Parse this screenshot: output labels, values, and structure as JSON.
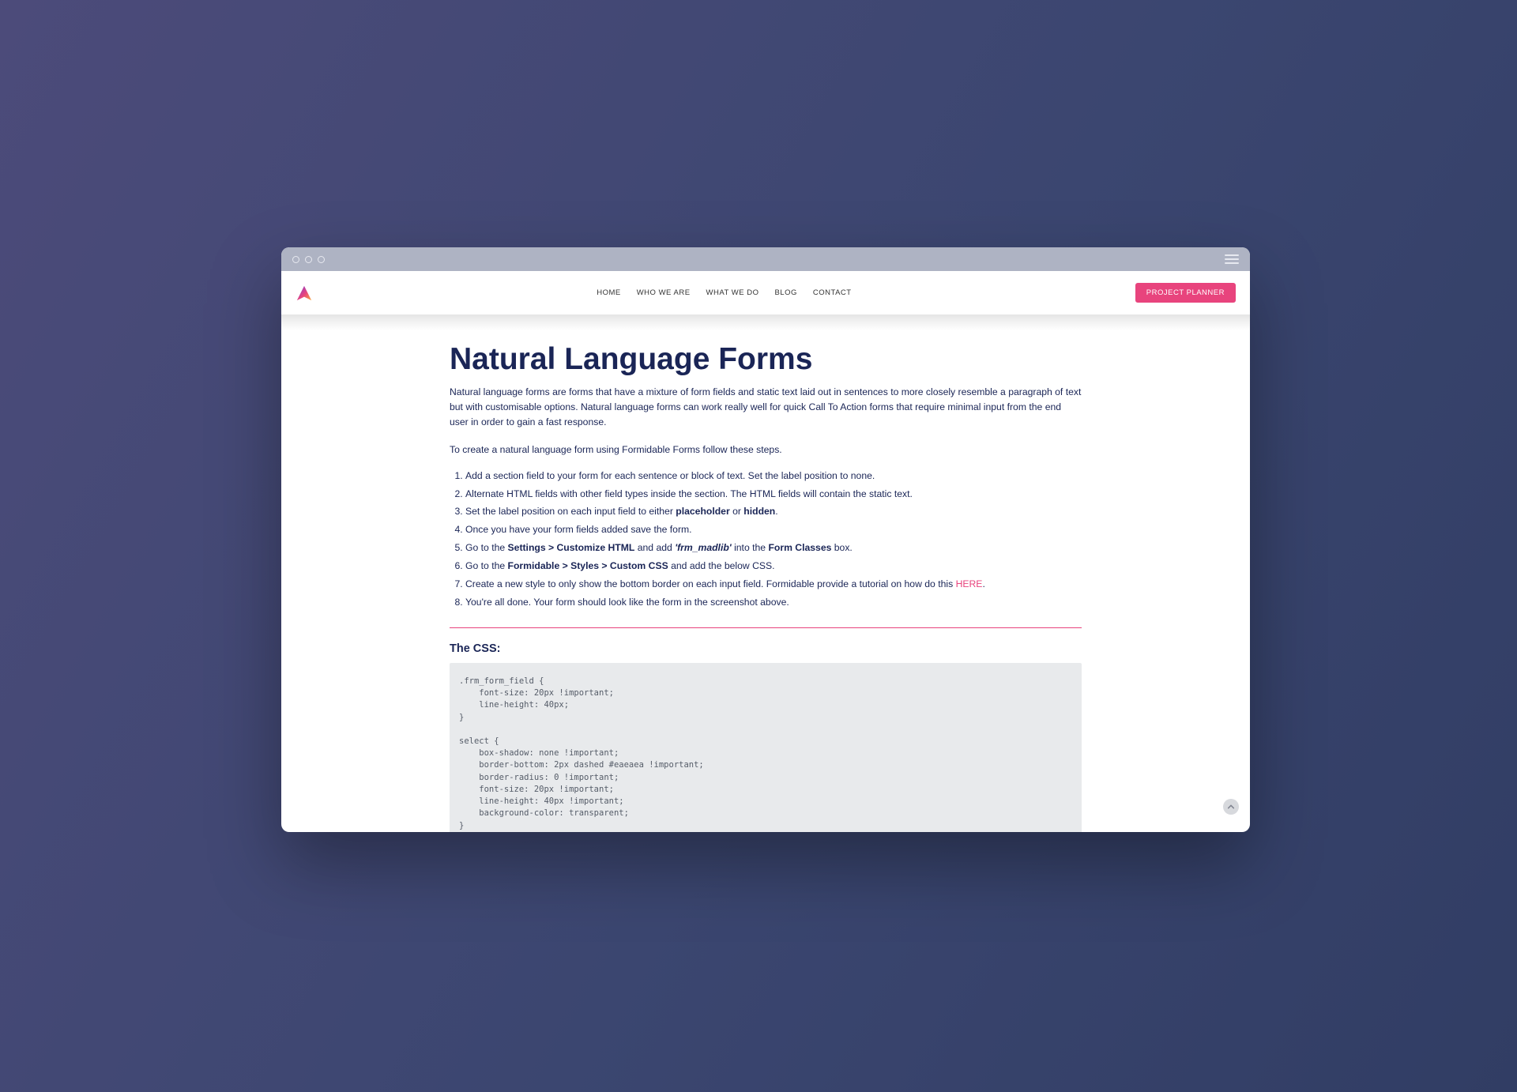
{
  "nav": {
    "items": [
      "HOME",
      "WHO WE ARE",
      "WHAT WE DO",
      "BLOG",
      "CONTACT"
    ],
    "cta": "PROJECT PLANNER"
  },
  "article": {
    "title": "Natural Language Forms",
    "intro": "Natural language forms are forms that have a mixture of form fields and static text laid out in sentences to more closely resemble a paragraph of text but with customisable options. Natural language forms can work really well for quick Call To Action forms that require minimal input from the end user in order to gain a fast response.",
    "lead": "To create a natural language form using Formidable Forms follow these steps.",
    "steps": [
      [
        {
          "t": "Add a section field to your form for each sentence or block of text. Set the label position to none."
        }
      ],
      [
        {
          "t": "Alternate HTML fields with other field types inside the section. The HTML fields will contain the static text."
        }
      ],
      [
        {
          "t": "Set the label position on each input field to either "
        },
        {
          "t": "placeholder",
          "b": true
        },
        {
          "t": " or "
        },
        {
          "t": "hidden",
          "b": true
        },
        {
          "t": "."
        }
      ],
      [
        {
          "t": "Once you have your form fields added save the form."
        }
      ],
      [
        {
          "t": "Go to the "
        },
        {
          "t": "Settings > Customize HTML",
          "b": true
        },
        {
          "t": " and add "
        },
        {
          "t": "'frm_madlib'",
          "i": true
        },
        {
          "t": " into the "
        },
        {
          "t": "Form Classes",
          "b": true
        },
        {
          "t": " box."
        }
      ],
      [
        {
          "t": "Go to the "
        },
        {
          "t": "Formidable > Styles > Custom CSS",
          "b": true
        },
        {
          "t": " and add the below CSS."
        }
      ],
      [
        {
          "t": "Create a new style to only show the bottom border on each input field. Formidable provide a tutorial on how do this "
        },
        {
          "t": "HERE",
          "link": true
        },
        {
          "t": "."
        }
      ],
      [
        {
          "t": "You're all done. Your form should look like the form in the screenshot above."
        }
      ]
    ],
    "css_heading": "The CSS:",
    "css_code": ".frm_form_field {\n    font-size: 20px !important;\n    line-height: 40px;\n}\n\nselect {\n    box-shadow: none !important;\n    border-bottom: 2px dashed #eaeaea !important;\n    border-radius: 0 !important;\n    font-size: 20px !important;\n    line-height: 40px !important;\n    background-color: transparent;\n}\n\n.frm_madlib .frm_section_heading {\n    display: flex !important;\n    flex-wrap: wrap;\n    align-items: flex-end;\n}\n\n.frm_madlib .frm_section_heading div {"
  }
}
